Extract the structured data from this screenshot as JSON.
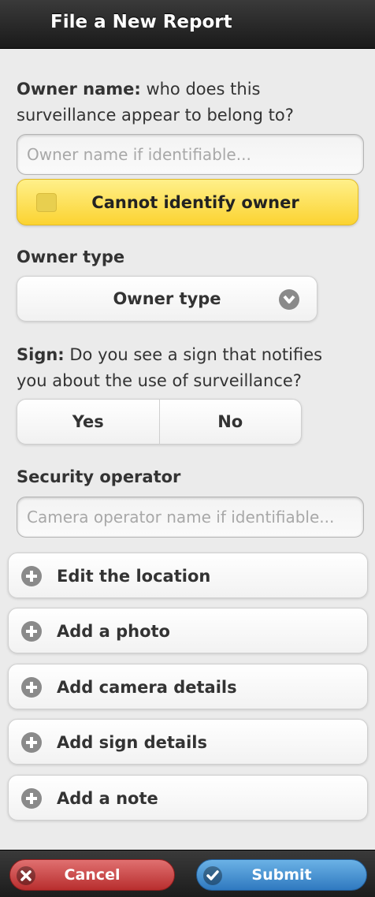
{
  "header": {
    "title": "File a New Report"
  },
  "owner": {
    "label_bold": "Owner name:",
    "label_rest": " who does this surveillance appear to belong to?",
    "placeholder": "Owner name if identifiable...",
    "cannot_identify_label": "Cannot identify owner",
    "cannot_identify_checked": false
  },
  "owner_type": {
    "label": "Owner type",
    "select_value": "Owner type"
  },
  "sign": {
    "label_bold": "Sign:",
    "label_rest": " Do you see a sign that notifies you about the use of surveillance?",
    "options": [
      "Yes",
      "No"
    ]
  },
  "security": {
    "label": "Security operator",
    "placeholder": "Camera operator name if identifiable..."
  },
  "sections": [
    "Edit the location",
    "Add a photo",
    "Add camera details",
    "Add sign details",
    "Add a note"
  ],
  "footer": {
    "cancel_label": "Cancel",
    "submit_label": "Submit"
  },
  "icons": {
    "checkbox": "checkbox-icon",
    "dropdown": "chevron-down-icon",
    "expand": "plus-icon",
    "cancel": "close-icon",
    "submit": "check-icon"
  },
  "colors": {
    "header": "#1a1a1a",
    "highlight_yellow": "#fbd331",
    "cancel_red": "#b82e2e",
    "submit_blue": "#2f79c0"
  }
}
